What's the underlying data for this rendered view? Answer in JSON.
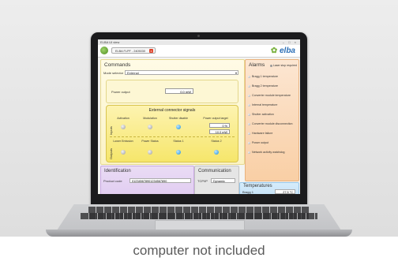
{
  "caption": "computer not included",
  "window": {
    "title": "ELBA UI view",
    "controls": "– □ ×"
  },
  "toolbar": {
    "device_tab": "ELBA FLPF - 2405030",
    "close_glyph": "x",
    "logo_text": "elba",
    "logo_icon": "leaf-icon"
  },
  "commands": {
    "title": "Commands",
    "mode_label": "Mode selector",
    "mode_value": "External",
    "power_label": "Power output",
    "power_value": "0.0 mW"
  },
  "external": {
    "title": "External connector signals",
    "inputs_label": "Inputs",
    "outputs_label": "Outputs",
    "input_columns": [
      "Activation",
      "Modulation",
      "Shutter disable",
      "Power output target"
    ],
    "input_states": [
      "off",
      "off",
      "on"
    ],
    "target_values": [
      "0 %",
      "10.0 mW"
    ],
    "output_columns": [
      "Lower Emission",
      "Power Status",
      "Status 1",
      "Status 2"
    ],
    "output_states": [
      "off",
      "off",
      "on",
      "on"
    ]
  },
  "alarms": {
    "title": "Alarms",
    "laser_stop": "Laser stop required",
    "items": [
      "Bragg 1 temperature",
      "Bragg 2 temperature",
      "Converter module temperature",
      "Internal temperature",
      "Shutter activation",
      "Converter module disconnection",
      "Hardware failure",
      "Power output",
      "Network activity watchdog"
    ]
  },
  "identification": {
    "title": "Identification",
    "product_label": "Product code",
    "product_value": "012345678901234567890"
  },
  "communication": {
    "title": "Communication",
    "label": "TCP/IP",
    "value": "Dynamic"
  },
  "temperatures": {
    "title": "Temperatures",
    "label": "Bragg 1",
    "value": "27.5 °C"
  }
}
